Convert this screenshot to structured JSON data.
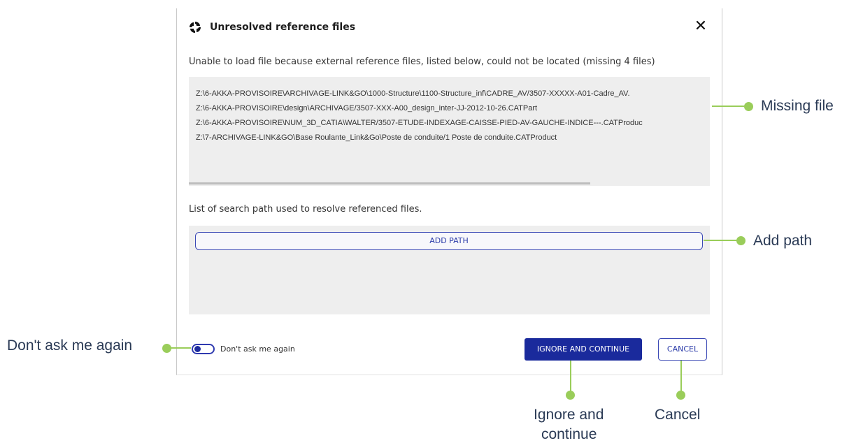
{
  "dialog": {
    "title": "Unresolved reference files",
    "close_icon": "close-icon",
    "message": "Unable to load file because external reference files, listed below, could not be located (missing 4 files)",
    "missing_files": [
      "Z:\\6-AKKA-PROVISOIRE\\ARCHIVAGE-LINK&GO\\1000-Structure\\1100-Structure_inf\\CADRE_AV/3507-XXXXX-A01-Cadre_AV.",
      "Z:\\6-AKKA-PROVISOIRE\\design\\ARCHIVAGE/3507-XXX-A00_design_inter-JJ-2012-10-26.CATPart",
      "Z:\\6-AKKA-PROVISOIRE\\NUM_3D_CATIA\\WALTER/3507-ETUDE-INDEXAGE-CAISSE-PIED-AV-GAUCHE-INDICE---.CATProduc",
      "Z:\\7-ARCHIVAGE-LINK&GO\\Base Roulante_Link&Go\\Poste de conduite/1 Poste de conduite.CATProduct"
    ],
    "search_path_label": "List of search path used to resolve referenced files.",
    "add_path_label": "ADD PATH",
    "dont_ask_label": "Don't ask me again",
    "ignore_label": "IGNORE AND CONTINUE",
    "cancel_label": "CANCEL"
  },
  "callouts": {
    "missing_file": "Missing file",
    "add_path": "Add path",
    "dont_ask": "Don't ask me again",
    "ignore_line1": "Ignore and",
    "ignore_line2": "continue",
    "cancel": "Cancel"
  },
  "colors": {
    "primary": "#1a2a9c",
    "callout": "#9acd5a",
    "panel_bg": "#eeeeee"
  }
}
